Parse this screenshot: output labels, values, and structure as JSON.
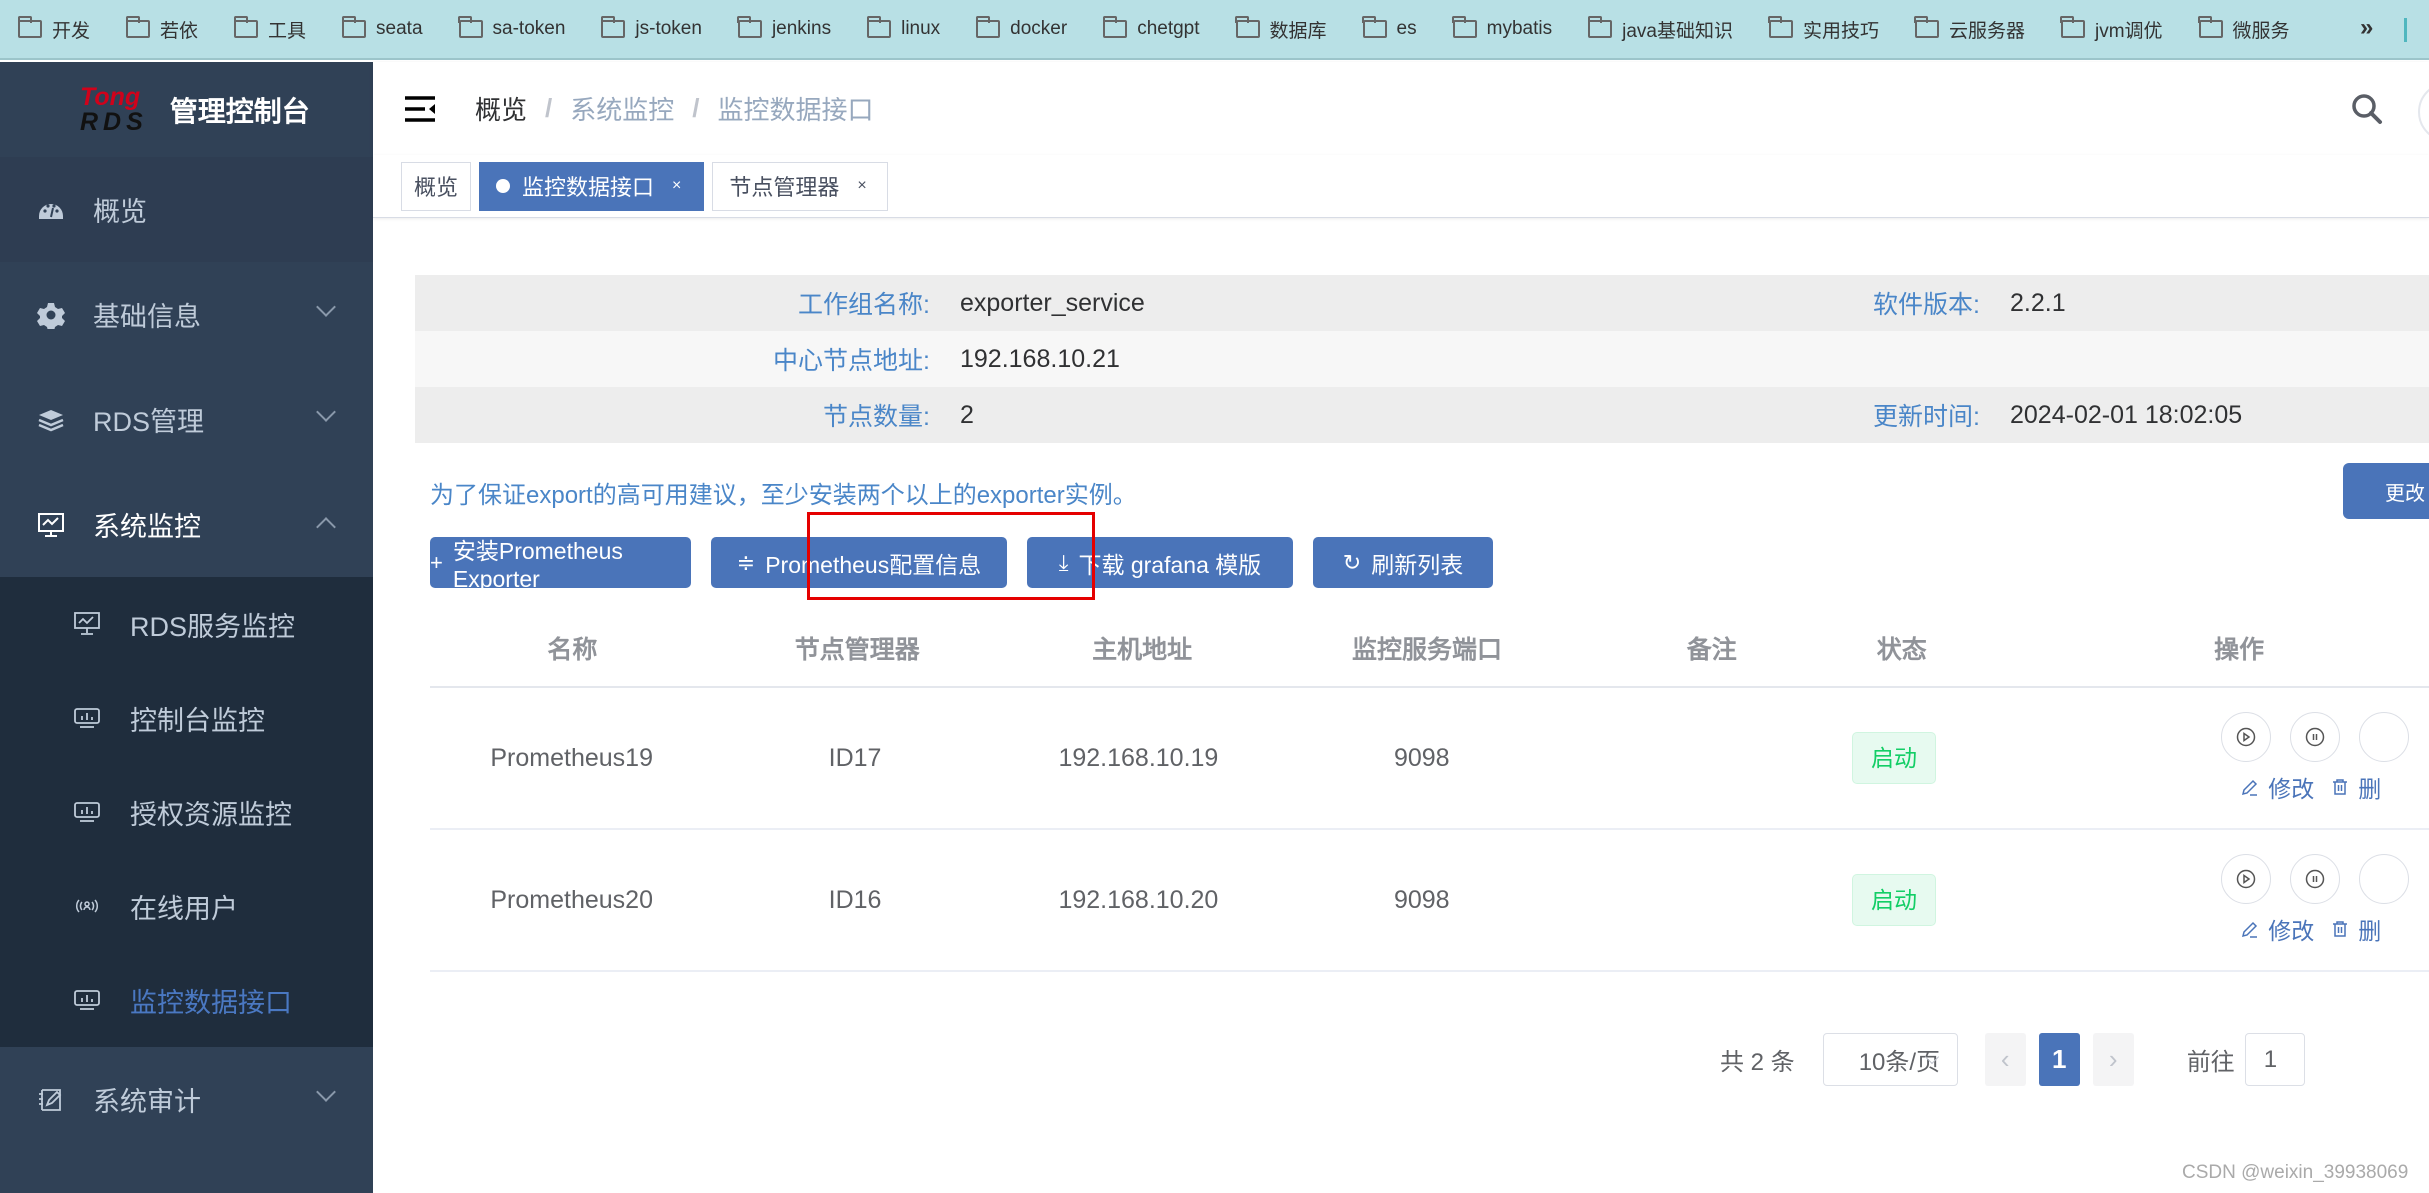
{
  "bookmarks": [
    "开发",
    "若依",
    "工具",
    "seata",
    "sa-token",
    "js-token",
    "jenkins",
    "linux",
    "docker",
    "chetgpt",
    "数据库",
    "es",
    "mybatis",
    "java基础知识",
    "实用技巧",
    "云服务器",
    "jvm调优",
    "微服务"
  ],
  "bookmarks_more": "»",
  "logo": {
    "tong": "Tong",
    "rds": "RDS",
    "title": "管理控制台"
  },
  "sidebar": {
    "items": [
      {
        "label": "概览",
        "icon": "dashboard-icon"
      },
      {
        "label": "基础信息",
        "icon": "gear-icon"
      },
      {
        "label": "RDS管理",
        "icon": "layers-icon"
      },
      {
        "label": "系统监控",
        "icon": "monitor-icon"
      }
    ],
    "submenu": [
      {
        "label": "RDS服务监控",
        "icon": "monitor-chart-icon"
      },
      {
        "label": "控制台监控",
        "icon": "monitor-bar-icon"
      },
      {
        "label": "授权资源监控",
        "icon": "monitor-bar-icon"
      },
      {
        "label": "在线用户",
        "icon": "online-user-icon"
      },
      {
        "label": "监控数据接口",
        "icon": "monitor-bar-icon",
        "active": true
      }
    ],
    "last": {
      "label": "系统审计",
      "icon": "audit-icon"
    }
  },
  "header": {
    "breadcrumb": [
      "概览",
      "系统监控",
      "监控数据接口"
    ],
    "separator": "/"
  },
  "tags": [
    {
      "label": "概览"
    },
    {
      "label": "监控数据接口",
      "active": true,
      "close": "×"
    },
    {
      "label": "节点管理器",
      "close": "×"
    }
  ],
  "info": {
    "group_name_label": "工作组名称:",
    "group_name": "exporter_service",
    "version_label": "软件版本:",
    "version": "2.2.1",
    "center_addr_label": "中心节点地址:",
    "center_addr": "192.168.10.21",
    "node_count_label": "节点数量:",
    "node_count": "2",
    "update_time_label": "更新时间:",
    "update_time": "2024-02-01 18:02:05"
  },
  "notice": "为了保证export的高可用建议，至少安装两个以上的exporter实例。",
  "change_button": "更改",
  "buttons": {
    "install": {
      "icon": "+",
      "label": "安装Prometheus Exporter"
    },
    "config": {
      "icon": "≑",
      "label": "Prometheus配置信息"
    },
    "download": {
      "icon": "⤓",
      "label": "下载 grafana 模版"
    },
    "refresh": {
      "icon": "↻",
      "label": "刷新列表"
    }
  },
  "table": {
    "columns": [
      "名称",
      "节点管理器",
      "主机地址",
      "监控服务端口",
      "备注",
      "状态",
      "操作"
    ],
    "rows": [
      {
        "name": "Prometheus19",
        "manager": "ID17",
        "host": "192.168.10.19",
        "port": "9098",
        "remark": "",
        "status": "启动",
        "edit": "修改",
        "delete": "删"
      },
      {
        "name": "Prometheus20",
        "manager": "ID16",
        "host": "192.168.10.20",
        "port": "9098",
        "remark": "",
        "status": "启动",
        "edit": "修改",
        "delete": "删"
      }
    ]
  },
  "pagination": {
    "total": "共 2 条",
    "page_size": "10条/页",
    "prev": "‹",
    "current": "1",
    "next": "›",
    "goto_label": "前往",
    "goto_value": "1"
  },
  "watermark": "CSDN @weixin_39938069",
  "colors": {
    "primary": "#4a74b9",
    "sidebar": "#304156",
    "submenu": "#1f2d3d",
    "success": "#13ce66",
    "label_blue": "#4a86c8",
    "highlight": "#e50000"
  }
}
